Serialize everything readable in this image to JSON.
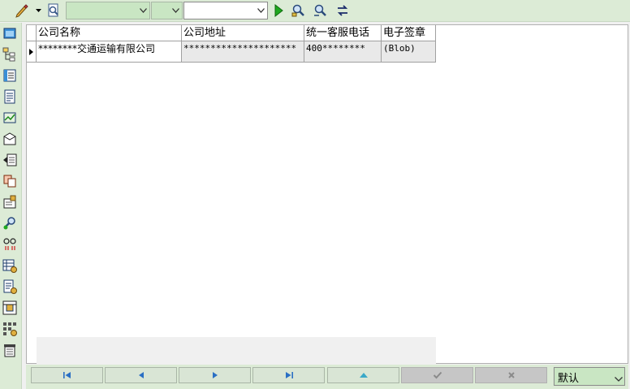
{
  "toolbar": {
    "icons": [
      "pencil-icon",
      "dropdown-arrow-icon",
      "magnifier-page-icon",
      "play-icon",
      "find-icon",
      "find-next-icon",
      "refresh-link-icon"
    ],
    "combo1_value": "",
    "combo2_value": "",
    "combo3_value": ""
  },
  "sidebar": {
    "icons": [
      "window-icon",
      "tree-icon",
      "list-icon",
      "document-icon",
      "chart-icon",
      "print-icon",
      "export-icon",
      "copy-icon",
      "settings-icon",
      "user-search-icon",
      "link-icon",
      "table-settings-icon",
      "report-settings-icon",
      "image-icon",
      "grid-settings-icon",
      "archive-icon"
    ]
  },
  "grid": {
    "columns": [
      "公司名称",
      "公司地址",
      "统一客服电话",
      "电子签章"
    ],
    "rows": [
      [
        "********交通运输有限公司",
        "*********************",
        "400********",
        "(Blob)"
      ]
    ]
  },
  "navbar": {
    "buttons": [
      "first-record-icon",
      "prior-record-icon",
      "next-record-icon",
      "last-record-icon",
      "insert-record-icon",
      "post-record-icon",
      "cancel-record-icon"
    ],
    "status_value": "默认"
  },
  "colors": {
    "toolbar_bg": "#dcebd6",
    "combo_bg": "#c9e6c3",
    "accent_green": "#1fa81f",
    "nav_arrow": "#2a6fc4"
  }
}
